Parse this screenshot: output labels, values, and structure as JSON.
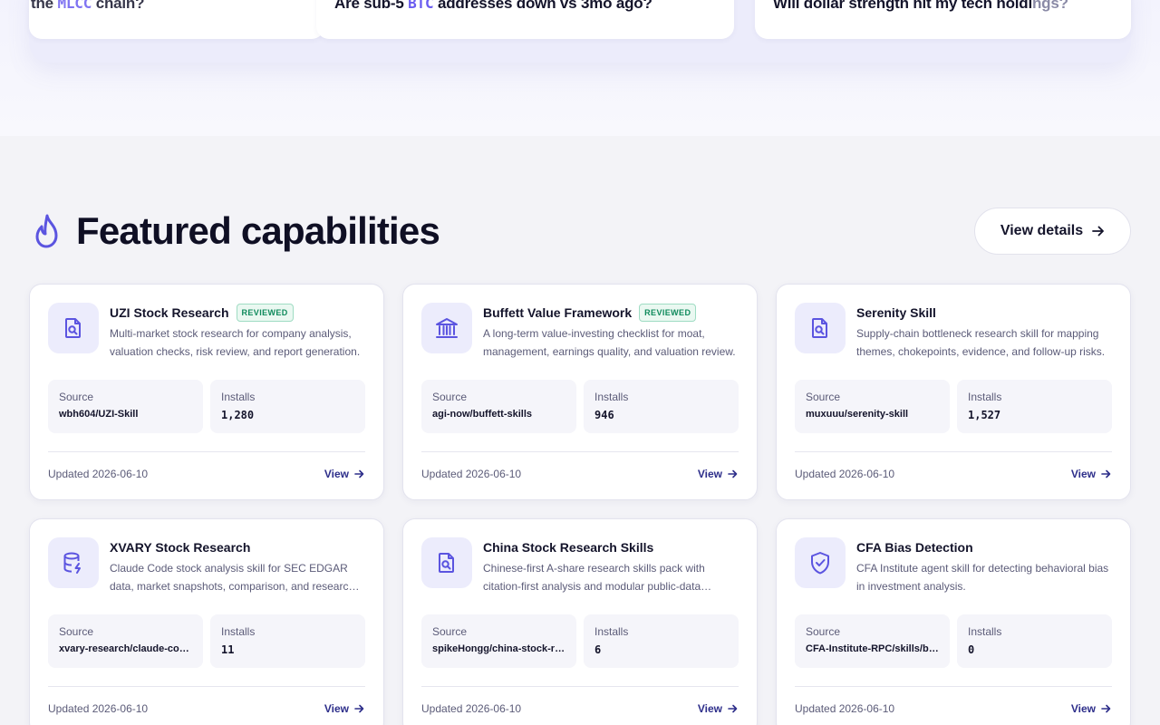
{
  "question_strip": {
    "cards": [
      {
        "pre": "the ",
        "highlight": "MLCC",
        "post": " chain?"
      },
      {
        "pre": "Are sub-5 ",
        "highlight": "BTC",
        "post": " addresses down vs 3mo ago?"
      },
      {
        "pre": "Will dollar strength hit my tech holdi",
        "highlight": "",
        "post": "ngs?"
      }
    ]
  },
  "section": {
    "title": "Featured capabilities",
    "icon": "flame-icon",
    "view_details_label": "View details"
  },
  "labels": {
    "source": "Source",
    "installs": "Installs",
    "view": "View"
  },
  "cards": [
    {
      "name": "UZI Stock Research",
      "badge": "REVIEWED",
      "icon": "file-search-icon",
      "description": "Multi-market stock research for company analysis, valuation checks, risk review, and report generation.",
      "source": "wbh604/UZI-Skill",
      "installs": "1,280",
      "updated": "Updated 2026-06-10"
    },
    {
      "name": "Buffett Value Framework",
      "badge": "REVIEWED",
      "icon": "bank-icon",
      "description": "A long-term value-investing checklist for moat, management, earnings quality, and valuation review.",
      "source": "agi-now/buffett-skills",
      "installs": "946",
      "updated": "Updated 2026-06-10"
    },
    {
      "name": "Serenity Skill",
      "badge": "",
      "icon": "file-search-icon",
      "description": "Supply-chain bottleneck research skill for mapping themes, chokepoints, evidence, and follow-up risks.",
      "source": "muxuuu/serenity-skill",
      "installs": "1,527",
      "updated": "Updated 2026-06-10"
    },
    {
      "name": "XVARY Stock Research",
      "badge": "",
      "icon": "database-bolt-icon",
      "description": "Claude Code stock analysis skill for SEC EDGAR data, market snapshots, comparison, and research reports.",
      "source": "xvary-research/claude-code-stock-analysis",
      "installs": "11",
      "updated": "Updated 2026-06-10"
    },
    {
      "name": "China Stock Research Skills",
      "badge": "",
      "icon": "file-search-icon",
      "description": "Chinese-first A-share research skills pack with citation-first analysis and modular public-data workflows.",
      "source": "spikeHongg/china-stock-research-skills",
      "installs": "6",
      "updated": "Updated 2026-06-10"
    },
    {
      "name": "CFA Bias Detection",
      "badge": "",
      "icon": "shield-check-icon",
      "description": "CFA Institute agent skill for detecting behavioral bias in investment analysis.",
      "source": "CFA-Institute-RPC/skills/bias-detection",
      "installs": "0",
      "updated": "Updated 2026-06-10"
    }
  ],
  "colors": {
    "accent": "#5b54e0",
    "badge_green": "#0f8a5c",
    "link": "#2d2e8a"
  }
}
